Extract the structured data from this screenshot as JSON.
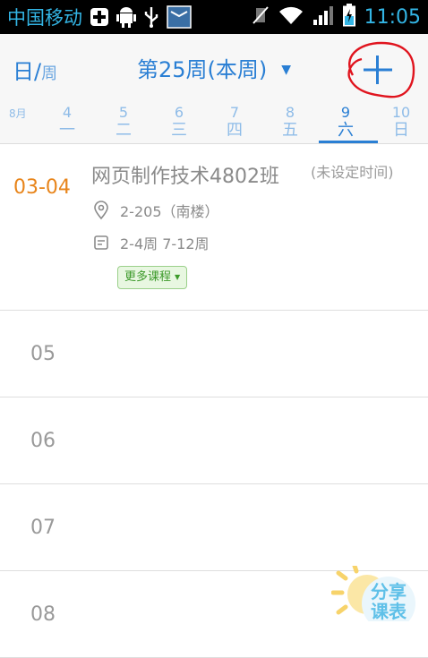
{
  "status_bar": {
    "carrier": "中国移动",
    "time": "11:05"
  },
  "header": {
    "mode_day": "日",
    "mode_sep": "/",
    "mode_week": "周",
    "week_title": "第25周(本周)",
    "add_icon": "plus-icon"
  },
  "day_strip": {
    "month": "8月",
    "days": [
      {
        "num": "4",
        "weekday": "一"
      },
      {
        "num": "5",
        "weekday": "二"
      },
      {
        "num": "6",
        "weekday": "三"
      },
      {
        "num": "7",
        "weekday": "四"
      },
      {
        "num": "8",
        "weekday": "五"
      },
      {
        "num": "9",
        "weekday": "六"
      },
      {
        "num": "10",
        "weekday": "日"
      }
    ],
    "selected_index": 5
  },
  "schedule": {
    "course": {
      "period": "03-04",
      "name": "网页制作技术4802班",
      "time_note": "(未设定时间)",
      "location": "2-205（南楼）",
      "weeks": "2-4周 7-12周",
      "more_label": "更多课程"
    },
    "empty_periods": [
      "05",
      "06",
      "07",
      "08"
    ]
  },
  "share": {
    "line1": "分享",
    "line2": "课表"
  },
  "colors": {
    "accent": "#2a7fd4",
    "period_highlight": "#e8851b",
    "tag_green": "#3c9a2a",
    "annotation_red": "#e0141e"
  }
}
